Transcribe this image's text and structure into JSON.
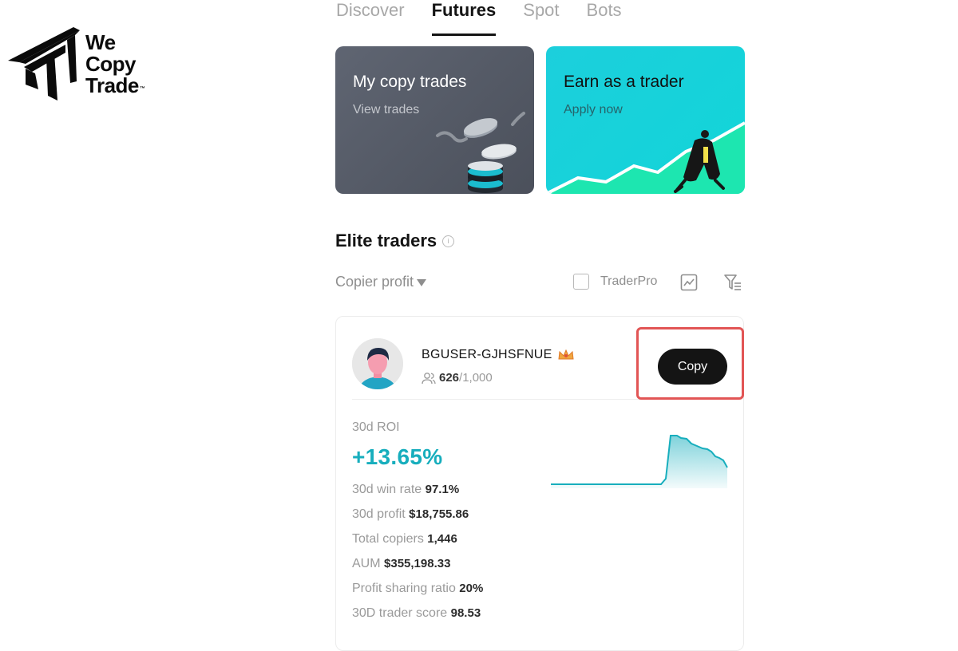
{
  "logo": {
    "line1": "We",
    "line2": "Copy",
    "line3": "Trade",
    "trademark": "™"
  },
  "tabs": [
    {
      "label": "Discover",
      "active": false
    },
    {
      "label": "Futures",
      "active": true
    },
    {
      "label": "Spot",
      "active": false
    },
    {
      "label": "Bots",
      "active": false
    }
  ],
  "promo": {
    "my_trades": {
      "title": "My copy trades",
      "subtitle": "View trades"
    },
    "earn": {
      "title": "Earn as a trader",
      "subtitle": "Apply now"
    }
  },
  "elite": {
    "title": "Elite traders",
    "info_glyph": "i"
  },
  "filters": {
    "sort_label": "Copier profit",
    "traderpro_label": "TraderPro",
    "traderpro_checked": false
  },
  "trader": {
    "username": "BGUSER-GJHSFNUE",
    "copiers_current": "626",
    "copiers_max": "/1,000",
    "copy_label": "Copy",
    "roi_label": "30d ROI",
    "roi_value": "+13.65%",
    "stats": [
      {
        "label": "30d win rate",
        "value": "97.1%"
      },
      {
        "label": "30d profit",
        "value": "$18,755.86"
      },
      {
        "label": "Total copiers",
        "value": "1,446"
      },
      {
        "label": "AUM",
        "value": "$355,198.33"
      },
      {
        "label": "Profit sharing ratio",
        "value": "20%"
      },
      {
        "label": "30D trader score",
        "value": "98.53"
      }
    ]
  },
  "colors": {
    "accent_roi": "#17aebd",
    "highlight": "#e25555",
    "copy_button_bg": "#141414",
    "earn_card_bg": "#1ccfdc",
    "trades_card_bg": "#565b66"
  },
  "icons": {
    "info": "info-icon",
    "sort": "caret-down-icon",
    "chart": "line-chart-icon",
    "filter": "filter-icon",
    "people": "people-icon",
    "badge": "crown-icon"
  }
}
